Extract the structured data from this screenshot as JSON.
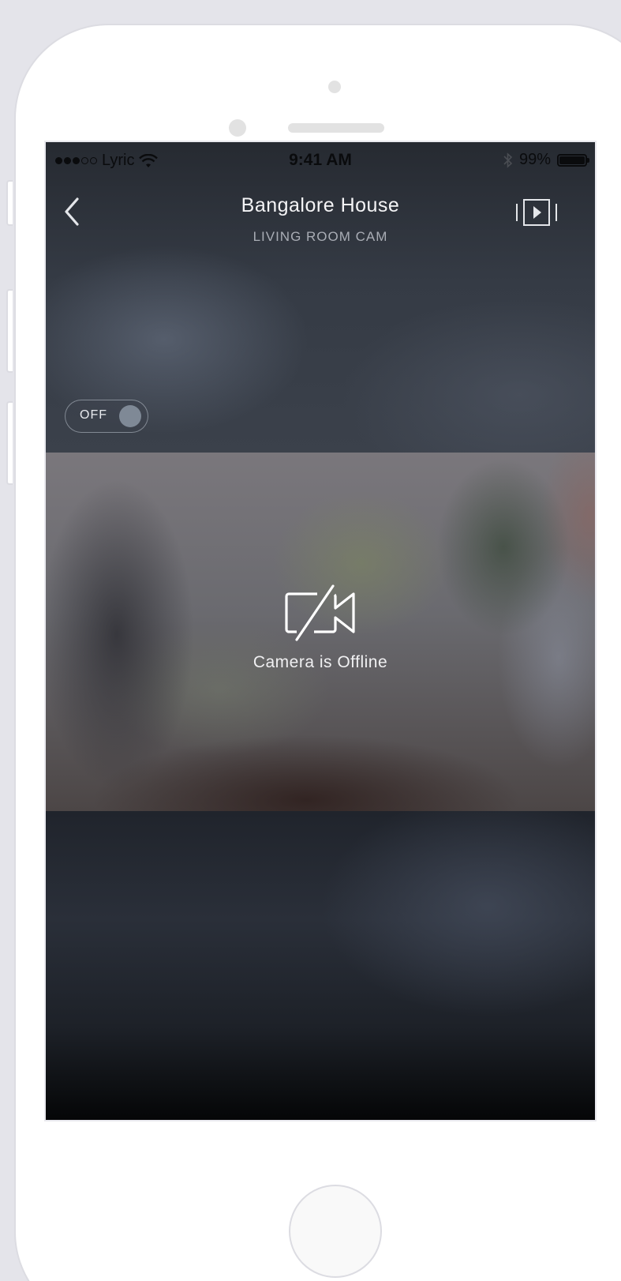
{
  "status_bar": {
    "carrier": "Lyric",
    "time": "9:41 AM",
    "battery_percent_label": "99%",
    "battery_level": 0.99,
    "signal_full_dots": 3,
    "signal_total_dots": 5
  },
  "nav": {
    "title": "Bangalore House",
    "subtitle": "LIVING ROOM CAM",
    "back_icon": "chevron-left-icon",
    "right_icon": "clip-play-icon"
  },
  "camera_toggle": {
    "label": "OFF",
    "on": false
  },
  "video": {
    "status_icon": "camera-off-icon",
    "status_text": "Camera is Offline"
  },
  "colors": {
    "toggle_knob": "#7f8996",
    "title_text": "#f4f4f6",
    "subtitle_text": "#a9adb5"
  }
}
